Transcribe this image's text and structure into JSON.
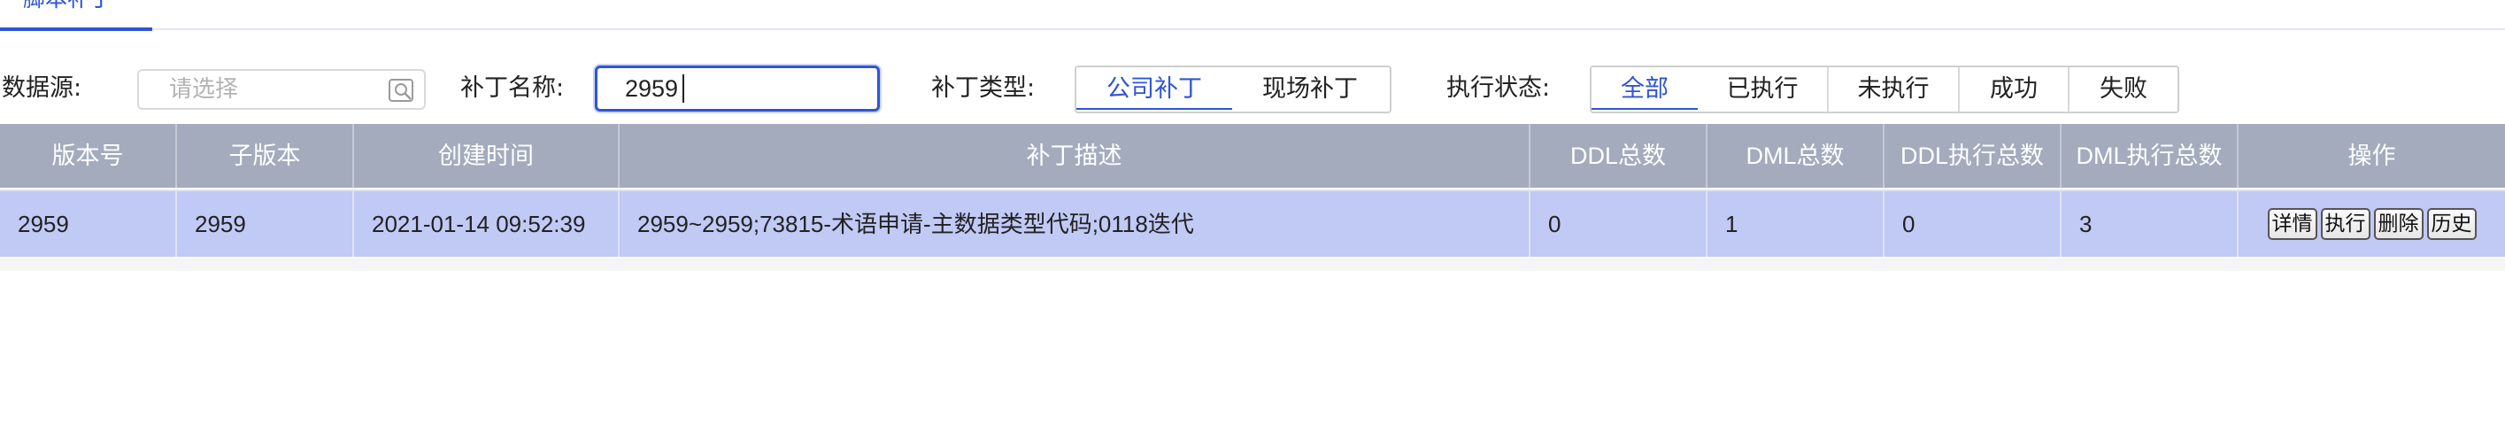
{
  "tabs": [
    {
      "label": "脚本补丁",
      "active": true
    }
  ],
  "filters": {
    "datasource_label": "数据源:",
    "datasource_placeholder": "请选择",
    "patch_name_label": "补丁名称:",
    "patch_name_value": "2959",
    "patch_type_label": "补丁类型:",
    "patch_type_options": [
      "公司补丁",
      "现场补丁"
    ],
    "patch_type_selected": "公司补丁",
    "exec_status_label": "执行状态:",
    "exec_status_options": [
      "全部",
      "已执行",
      "未执行",
      "成功",
      "失败"
    ],
    "exec_status_selected": "全部"
  },
  "table": {
    "columns": [
      "版本号",
      "子版本",
      "创建时间",
      "补丁描述",
      "DDL总数",
      "DML总数",
      "DDL执行总数",
      "DML执行总数",
      "操作"
    ],
    "rows": [
      {
        "version": "2959",
        "sub_version": "2959",
        "created": "2021-01-14 09:52:39",
        "description": "2959~2959;73815-术语申请-主数据类型代码;0118迭代",
        "ddl_total": "0",
        "dml_total": "1",
        "ddl_exec_total": "0",
        "dml_exec_total": "3",
        "actions": [
          "详情",
          "执行",
          "删除",
          "历史"
        ]
      }
    ]
  },
  "colors": {
    "accent": "#2f54d6",
    "header_bg": "#a3abbd",
    "row_selected_bg": "#c1c9f5"
  }
}
